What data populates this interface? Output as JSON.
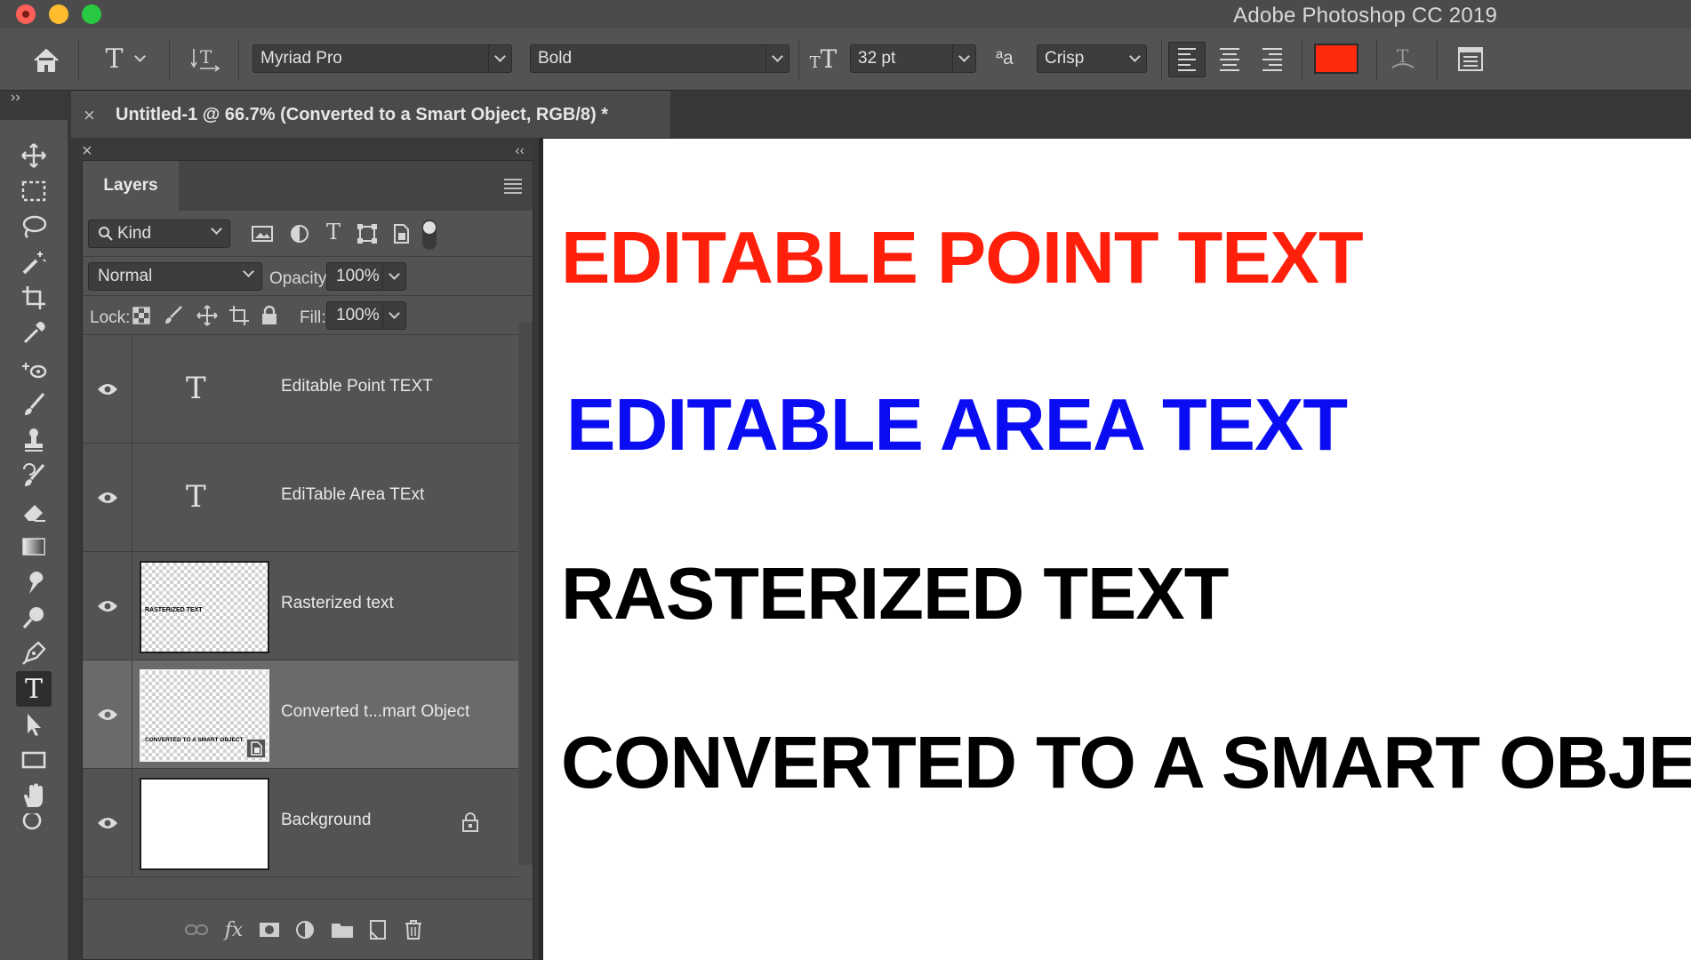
{
  "app": {
    "title": "Adobe Photoshop CC 2019"
  },
  "options_bar": {
    "font_family": "Myriad Pro",
    "font_style": "Bold",
    "font_size": "32 pt",
    "antialias_glyph": "ªa",
    "antialias": "Crisp",
    "text_color": "#ff2a0c"
  },
  "document_tab": {
    "close": "×",
    "title": "Untitled-1 @ 66.7% (Converted to a Smart Object, RGB/8) *"
  },
  "layers_panel": {
    "tab_label": "Layers",
    "filter_kind": "Kind",
    "blend_mode": "Normal",
    "opacity_label": "Opacity:",
    "opacity_value": "100%",
    "lock_label": "Lock:",
    "fill_label": "Fill:",
    "fill_value": "100%",
    "footer_fx": "fx",
    "layers": [
      {
        "name": "Editable Point TEXT",
        "kind": "text",
        "glyph": "T",
        "visible": true,
        "selected": false
      },
      {
        "name": "EdiTable Area TExt",
        "kind": "text",
        "glyph": "T",
        "visible": true,
        "selected": false
      },
      {
        "name": "Rasterized text",
        "kind": "raster",
        "thumb_text": "RASTERIZED TEXT",
        "visible": true,
        "selected": false
      },
      {
        "name": "Converted t...mart Object",
        "kind": "smart-object",
        "thumb_text": "CONVERTED TO A SMART OBJECT",
        "visible": true,
        "selected": true
      },
      {
        "name": "Background",
        "kind": "background",
        "visible": true,
        "selected": false,
        "locked": true
      }
    ]
  },
  "canvas": {
    "lines": [
      {
        "text": "EDITABLE POINT TEXT",
        "color": "#ff1f0b"
      },
      {
        "text": "EDITABLE AREA TEXT",
        "color": "#0a0cf2"
      },
      {
        "text": "RASTERIZED TEXT",
        "color": "#000000"
      },
      {
        "text": "CONVERTED TO A SMART OBJECT",
        "color": "#000000"
      }
    ]
  }
}
